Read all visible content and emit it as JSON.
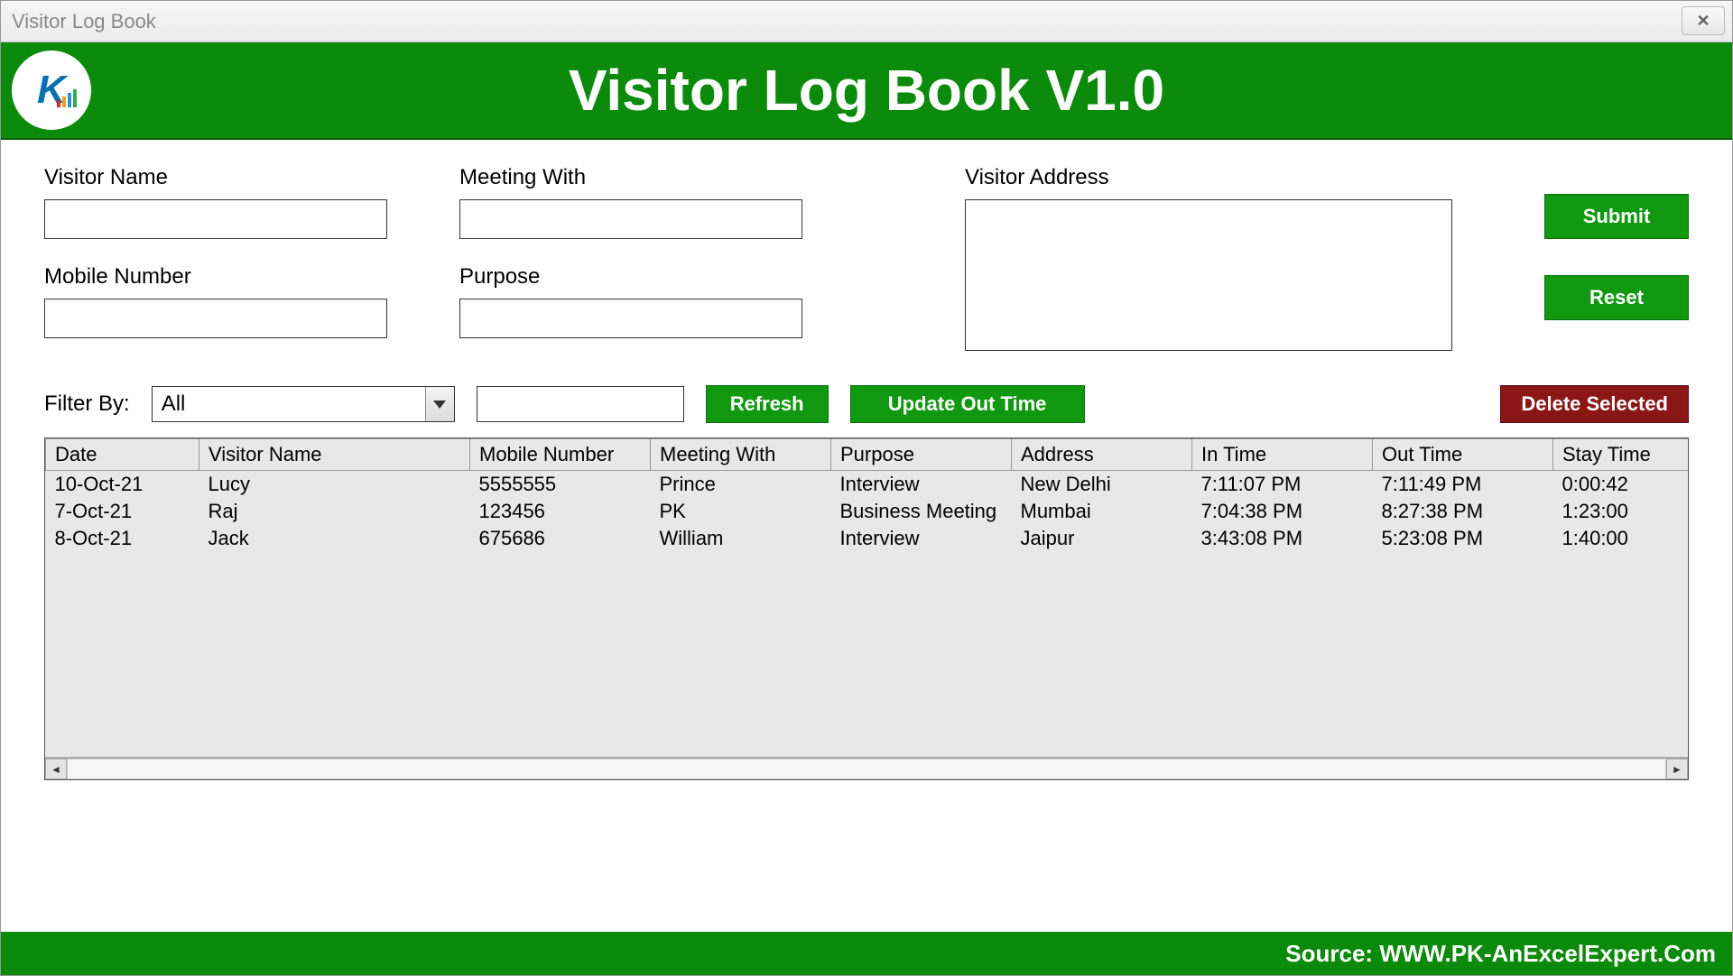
{
  "window": {
    "title": "Visitor Log Book"
  },
  "banner": {
    "title": "Visitor Log Book V1.0"
  },
  "form": {
    "visitor_name_label": "Visitor Name",
    "meeting_with_label": "Meeting With",
    "visitor_address_label": "Visitor Address",
    "mobile_number_label": "Mobile Number",
    "purpose_label": "Purpose",
    "visitor_name_value": "",
    "meeting_with_value": "",
    "visitor_address_value": "",
    "mobile_number_value": "",
    "purpose_value": ""
  },
  "buttons": {
    "submit": "Submit",
    "reset": "Reset",
    "refresh": "Refresh",
    "update_out_time": "Update Out Time",
    "delete_selected": "Delete Selected"
  },
  "filter": {
    "label": "Filter By:",
    "selected": "All",
    "search_value": ""
  },
  "grid": {
    "columns": [
      "Date",
      "Visitor Name",
      "Mobile Number",
      "Meeting With",
      "Purpose",
      "Address",
      "In Time",
      "Out Time",
      "Stay Time"
    ],
    "rows": [
      {
        "date": "10-Oct-21",
        "name": "Lucy",
        "mobile": "5555555",
        "meeting": "Prince",
        "purpose": "Interview",
        "address": "New Delhi",
        "in": "7:11:07 PM",
        "out": "7:11:49 PM",
        "stay": "0:00:42"
      },
      {
        "date": "7-Oct-21",
        "name": "Raj",
        "mobile": "123456",
        "meeting": "PK",
        "purpose": "Business Meeting",
        "address": "Mumbai",
        "in": "7:04:38 PM",
        "out": "8:27:38 PM",
        "stay": "1:23:00"
      },
      {
        "date": "8-Oct-21",
        "name": "Jack",
        "mobile": "675686",
        "meeting": "William",
        "purpose": "Interview",
        "address": "Jaipur",
        "in": "3:43:08 PM",
        "out": "5:23:08 PM",
        "stay": "1:40:00"
      }
    ]
  },
  "footer": {
    "text": "Source: WWW.PK-AnExcelExpert.Com"
  }
}
